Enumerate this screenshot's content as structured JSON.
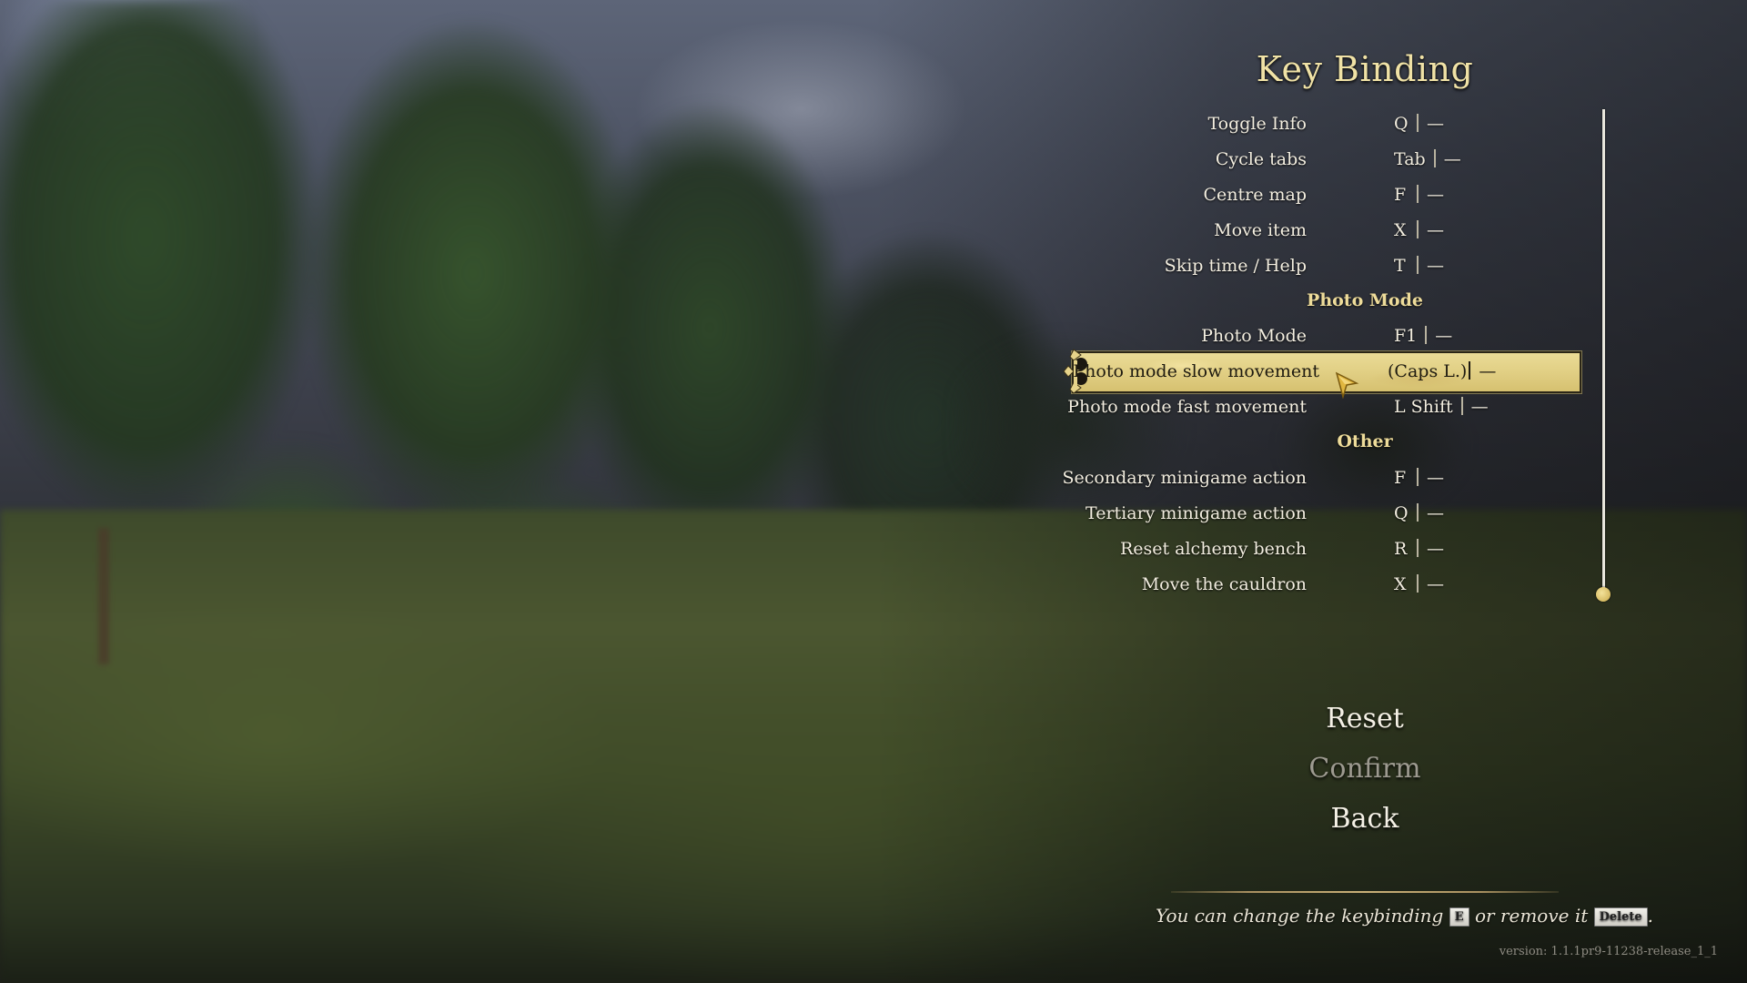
{
  "screen": {
    "title": "Key Binding"
  },
  "bindings": [
    {
      "type": "row",
      "action": "Toggle Info",
      "primary": "Q",
      "secondary": "—"
    },
    {
      "type": "row",
      "action": "Cycle tabs",
      "primary": "Tab",
      "secondary": "—"
    },
    {
      "type": "row",
      "action": "Centre map",
      "primary": "F",
      "secondary": "—"
    },
    {
      "type": "row",
      "action": "Move item",
      "primary": "X",
      "secondary": "—"
    },
    {
      "type": "row",
      "action": "Skip time / Help",
      "primary": "T",
      "secondary": "—"
    },
    {
      "type": "section",
      "label": "Photo Mode"
    },
    {
      "type": "row",
      "action": "Photo Mode",
      "primary": "F1",
      "secondary": "—"
    },
    {
      "type": "row",
      "action": "Photo mode slow movement",
      "primary": "(Caps L.)",
      "secondary": "—",
      "selected": true
    },
    {
      "type": "row",
      "action": "Photo mode fast movement",
      "primary": "L Shift",
      "secondary": "—"
    },
    {
      "type": "section",
      "label": "Other"
    },
    {
      "type": "row",
      "action": "Secondary minigame action",
      "primary": "F",
      "secondary": "—"
    },
    {
      "type": "row",
      "action": "Tertiary minigame action",
      "primary": "Q",
      "secondary": "—"
    },
    {
      "type": "row",
      "action": "Reset alchemy bench",
      "primary": "R",
      "secondary": "—"
    },
    {
      "type": "row",
      "action": "Move the cauldron",
      "primary": "X",
      "secondary": "—"
    }
  ],
  "scrollbar": {
    "position_fraction": 1.0
  },
  "menu": {
    "reset": "Reset",
    "confirm": "Confirm",
    "back": "Back"
  },
  "hint": {
    "text_before": "You can change the keybinding",
    "change_key": "E",
    "text_middle": "or remove it",
    "remove_key": "Delete",
    "text_after": "."
  },
  "version": "version: 1.1.1pr9-11238-release_1_1",
  "colors": {
    "title": "#f0e2a6",
    "section": "#eedc9a",
    "highlight": "#e1cf84",
    "text": "#f3eee0",
    "disabled": "#9d9a90"
  }
}
